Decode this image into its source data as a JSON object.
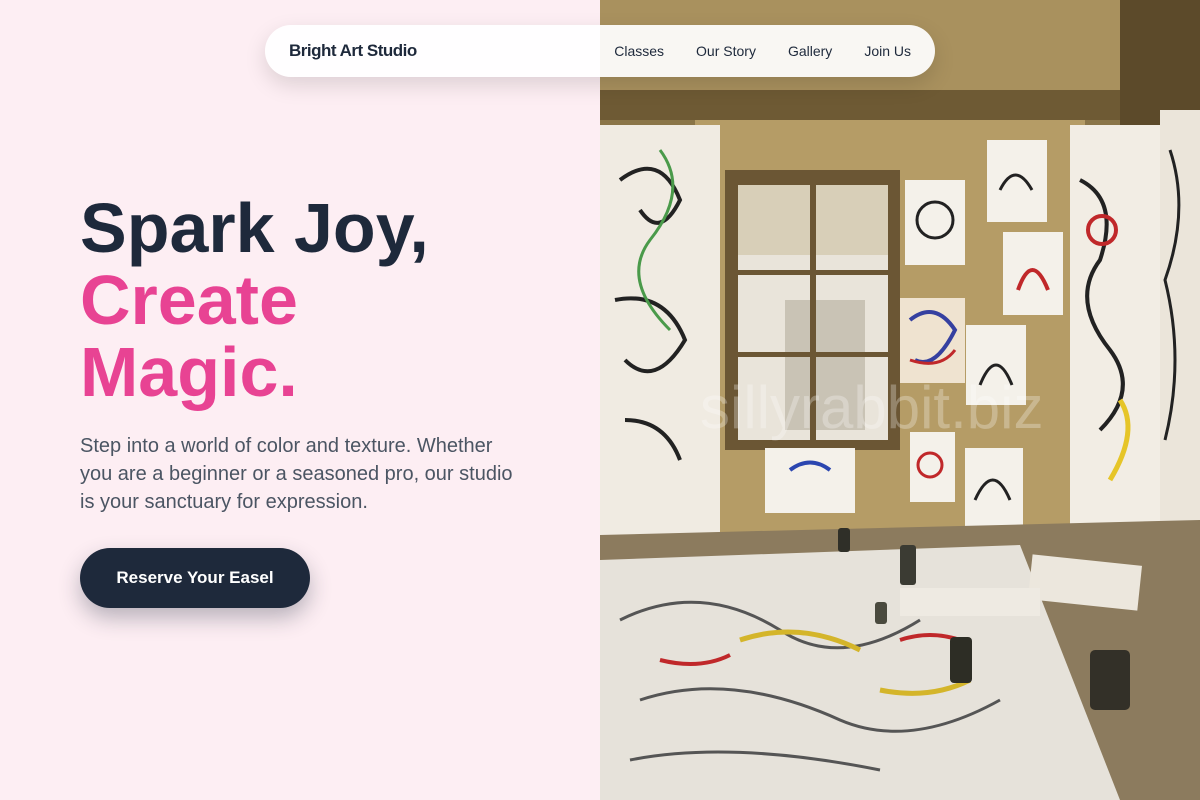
{
  "nav": {
    "brand": "Bright Art Studio",
    "links": [
      "Classes",
      "Our Story",
      "Gallery",
      "Join Us"
    ]
  },
  "hero": {
    "line1": "Spark Joy,",
    "line2": "Create",
    "line3": "Magic.",
    "description": "Step into a world of color and texture. Whether you are a beginner or a seasoned pro, our studio is your sanctuary for expression.",
    "cta_label": "Reserve Your Easel"
  },
  "photo": {
    "watermark": "sillyrabbit.biz"
  },
  "colors": {
    "background": "#fdeef3",
    "dark": "#1e293b",
    "accent": "#e84393",
    "body_text": "#4b5563"
  }
}
